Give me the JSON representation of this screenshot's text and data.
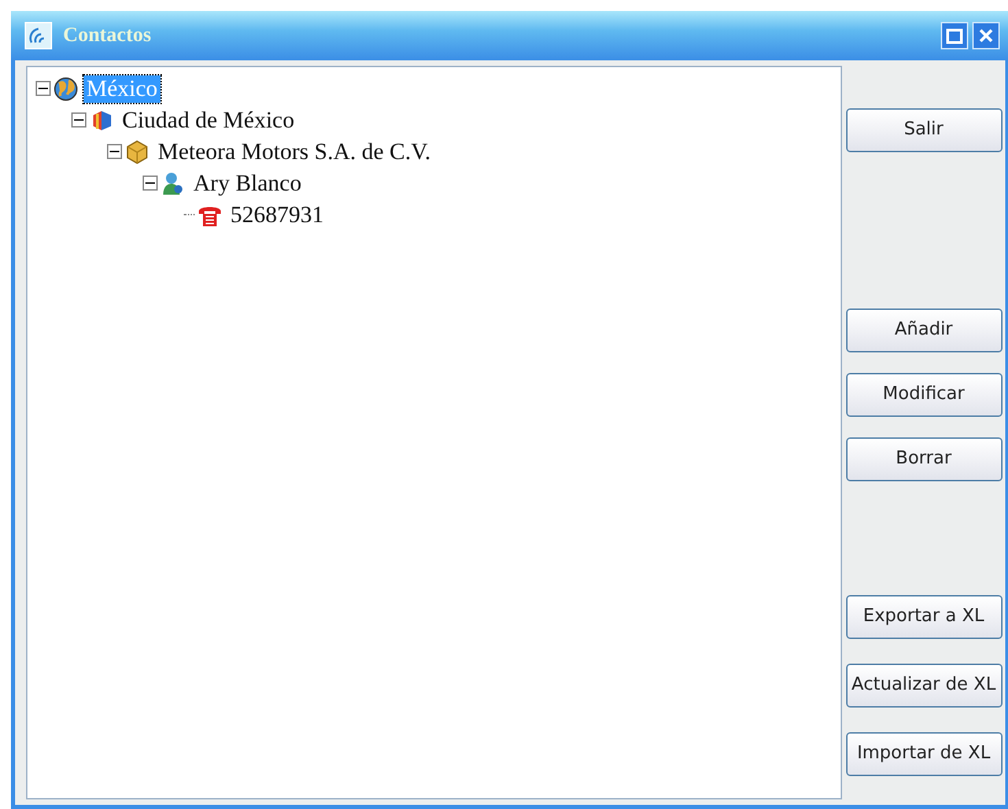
{
  "window": {
    "title": "Contactos"
  },
  "tree": [
    {
      "label": "México",
      "kind": "country",
      "expanded": true,
      "selected": true,
      "children": [
        {
          "label": "Ciudad de México",
          "kind": "city",
          "expanded": true,
          "selected": false,
          "children": [
            {
              "label": "Meteora Motors S.A. de C.V.",
              "kind": "company",
              "expanded": true,
              "selected": false,
              "children": [
                {
                  "label": "Ary Blanco",
                  "kind": "person",
                  "expanded": true,
                  "selected": false,
                  "children": [
                    {
                      "label": "52687931",
                      "kind": "phone",
                      "selected": false
                    }
                  ]
                }
              ]
            }
          ]
        }
      ]
    }
  ],
  "button_groups": [
    [
      "Salir"
    ],
    [
      "Añadir",
      "Modificar",
      "Borrar"
    ],
    [
      "Exportar a XL",
      "Actualizar de XL",
      "Importar de XL"
    ]
  ]
}
